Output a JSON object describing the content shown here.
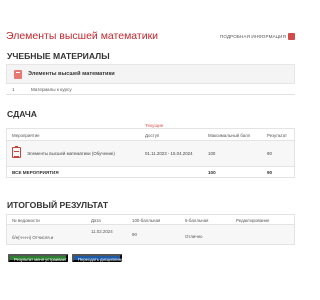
{
  "page": {
    "title": "Элементы высшей математики",
    "more_info": "ПОДРОБНАЯ ИНФОРМАЦИЯ"
  },
  "materials": {
    "heading": "УЧЕБНЫЕ МАТЕРИАЛЫ",
    "card_name": "Элементы высшей математики",
    "row": {
      "num": "1",
      "label": "Материалы к курсу"
    }
  },
  "submission": {
    "heading": "СДАЧА",
    "current_label": "Текущие",
    "headers": {
      "activity": "Мероприятие",
      "access": "Доступ",
      "max_score": "Максимальный балл",
      "result": "Результат"
    },
    "row": {
      "name": "Элементы высшей математики (Обучение)",
      "access": "01.11.2023 - 15.04.2024",
      "max_score": "100",
      "result": "90"
    },
    "total": {
      "label": "ВСЕ МЕРОПРИЯТИЯ",
      "max_score": "100",
      "result": "90"
    }
  },
  "final": {
    "heading": "ИТОГОВЫЙ РЕЗУЛЬТАТ",
    "headers": {
      "statement": "№ ведомости",
      "date": "Дата",
      "score100": "100-балльная",
      "score5": "5-балльная",
      "editing": "Редактирование"
    },
    "row": {
      "statement": "б/н(ч-н-н) Отчисля.и",
      "date": "11.02.2024",
      "score100": "90",
      "score5": "Отлично"
    }
  },
  "buttons": {
    "accept": "Результат меня устраивает",
    "retake": "Пересдать дисциплину"
  },
  "colors": {
    "title_red": "#c0272d",
    "accept_green": "#2e7d32",
    "retake_blue": "#1f5aa6"
  }
}
